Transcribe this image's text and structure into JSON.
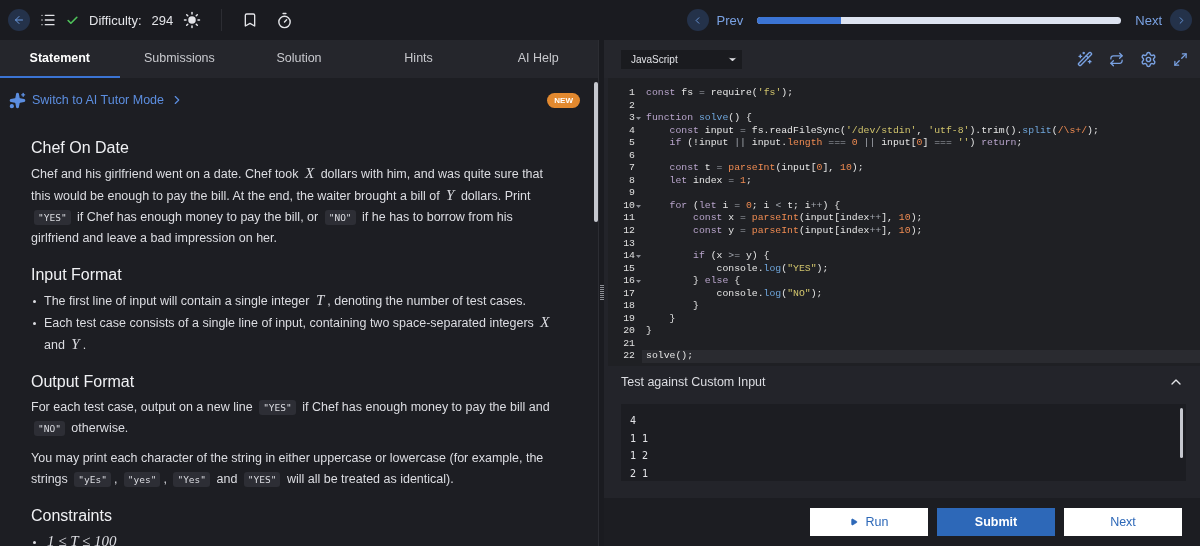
{
  "header": {
    "difficulty_label": "Difficulty:",
    "difficulty_value": "294",
    "solved": true,
    "prev_label": "Prev",
    "next_label": "Next",
    "progress": {
      "level": 0.23
    }
  },
  "tabs": [
    {
      "label": "Statement",
      "selected": true
    },
    {
      "label": "Submissions",
      "selected": false
    },
    {
      "label": "Solution",
      "selected": false
    },
    {
      "label": "Hints",
      "selected": false
    },
    {
      "label": "AI Help",
      "selected": false
    }
  ],
  "ai_tutor": {
    "label": "Switch to AI Tutor Mode",
    "badge": "NEW"
  },
  "statement": [
    {
      "heading": "Chef On Date",
      "blocks": [
        {
          "kind": "paragraph",
          "segments": [
            {
              "kind": "text",
              "text": "Chef and his girlfriend went on a date. Chef took "
            },
            {
              "kind": "math",
              "text": "X"
            },
            {
              "kind": "text",
              "text": " dollars with him, and was quite sure that this would be enough to pay the bill. At the end, the waiter brought a bill of "
            },
            {
              "kind": "math",
              "text": "Y"
            },
            {
              "kind": "text",
              "text": " dollars. Print "
            },
            {
              "kind": "code",
              "text": "\"YES\""
            },
            {
              "kind": "text",
              "text": " if Chef has enough money to pay the bill, or "
            },
            {
              "kind": "code",
              "text": "\"NO\""
            },
            {
              "kind": "text",
              "text": " if he has to borrow from his girlfriend and leave a bad impression on her."
            }
          ]
        }
      ]
    },
    {
      "heading": "Input Format",
      "blocks": [
        {
          "kind": "bullets",
          "items": [
            [
              {
                "kind": "text",
                "text": "The first line of input will contain a single integer "
              },
              {
                "kind": "math",
                "text": "T"
              },
              {
                "kind": "text",
                "text": ", denoting the number of test cases."
              }
            ],
            [
              {
                "kind": "text",
                "text": "Each test case consists of a single line of input, containing two space-separated integers "
              },
              {
                "kind": "math",
                "text": "X"
              },
              {
                "kind": "text",
                "text": " and "
              },
              {
                "kind": "math",
                "text": "Y"
              },
              {
                "kind": "text",
                "text": "."
              }
            ]
          ]
        }
      ]
    },
    {
      "heading": "Output Format",
      "blocks": [
        {
          "kind": "paragraph",
          "segments": [
            {
              "kind": "text",
              "text": "For each test case, output on a new line "
            },
            {
              "kind": "code",
              "text": "\"YES\""
            },
            {
              "kind": "text",
              "text": " if Chef has enough money to pay the bill and "
            },
            {
              "kind": "code",
              "text": "\"NO\""
            },
            {
              "kind": "text",
              "text": " otherwise."
            }
          ]
        },
        {
          "kind": "paragraph",
          "segments": [
            {
              "kind": "text",
              "text": "You may print each character of the string in either uppercase or lowercase (for example, the strings "
            },
            {
              "kind": "code",
              "text": "\"yEs\""
            },
            {
              "kind": "text",
              "text": ", "
            },
            {
              "kind": "code",
              "text": "\"yes\""
            },
            {
              "kind": "text",
              "text": ", "
            },
            {
              "kind": "code",
              "text": "\"Yes\""
            },
            {
              "kind": "text",
              "text": " and "
            },
            {
              "kind": "code",
              "text": "\"YES\""
            },
            {
              "kind": "text",
              "text": " will all be treated as identical)."
            }
          ]
        }
      ]
    },
    {
      "heading": "Constraints",
      "blocks": [
        {
          "kind": "bullets",
          "items": [
            [
              {
                "kind": "math",
                "text": "1 ≤ T ≤ 100"
              }
            ]
          ]
        }
      ]
    }
  ],
  "editor": {
    "language": "JavaScript",
    "lines": [
      {
        "number": "1",
        "foldable": false,
        "active": false,
        "tokens": [
          {
            "kind": "kw",
            "text": "const"
          },
          {
            "kind": "plain",
            "text": " fs "
          },
          {
            "kind": "op",
            "text": "="
          },
          {
            "kind": "plain",
            "text": " require("
          },
          {
            "kind": "str",
            "text": "'fs'"
          },
          {
            "kind": "plain",
            "text": ");"
          }
        ]
      },
      {
        "number": "2",
        "foldable": false,
        "active": false
      },
      {
        "number": "3",
        "foldable": true,
        "active": false,
        "tokens": [
          {
            "kind": "kw",
            "text": "function"
          },
          {
            "kind": "fn",
            "text": " solve"
          },
          {
            "kind": "plain",
            "text": "() {"
          }
        ]
      },
      {
        "number": "4",
        "foldable": false,
        "active": false,
        "tokens": [
          {
            "kind": "kw",
            "text": "    const"
          },
          {
            "kind": "plain",
            "text": " input "
          },
          {
            "kind": "op",
            "text": "="
          },
          {
            "kind": "plain",
            "text": " fs.readFileSync("
          },
          {
            "kind": "str",
            "text": "'/dev/stdin'"
          },
          {
            "kind": "plain",
            "text": ", "
          },
          {
            "kind": "str",
            "text": "'utf-8'"
          },
          {
            "kind": "plain",
            "text": ").trim()."
          },
          {
            "kind": "fn",
            "text": "split"
          },
          {
            "kind": "plain",
            "text": "("
          },
          {
            "kind": "num",
            "text": "/\\s+/"
          },
          {
            "kind": "plain",
            "text": ");"
          }
        ]
      },
      {
        "number": "5",
        "foldable": false,
        "active": false,
        "tokens": [
          {
            "kind": "kw",
            "text": "    if"
          },
          {
            "kind": "plain",
            "text": " (!input "
          },
          {
            "kind": "op",
            "text": "||"
          },
          {
            "kind": "plain",
            "text": " input."
          },
          {
            "kind": "num",
            "text": "length"
          },
          {
            "kind": "op",
            "text": " === "
          },
          {
            "kind": "num",
            "text": "0"
          },
          {
            "kind": "op",
            "text": " || "
          },
          {
            "kind": "plain",
            "text": "input["
          },
          {
            "kind": "num",
            "text": "0"
          },
          {
            "kind": "plain",
            "text": "] "
          },
          {
            "kind": "op",
            "text": "==="
          },
          {
            "kind": "str",
            "text": " ''"
          },
          {
            "kind": "plain",
            "text": ") "
          },
          {
            "kind": "kw",
            "text": "return"
          },
          {
            "kind": "plain",
            "text": ";"
          }
        ]
      },
      {
        "number": "6",
        "foldable": false,
        "active": false
      },
      {
        "number": "7",
        "foldable": false,
        "active": false,
        "tokens": [
          {
            "kind": "kw",
            "text": "    const"
          },
          {
            "kind": "plain",
            "text": " t "
          },
          {
            "kind": "op",
            "text": "="
          },
          {
            "kind": "num",
            "text": " parseInt"
          },
          {
            "kind": "plain",
            "text": "(input["
          },
          {
            "kind": "num",
            "text": "0"
          },
          {
            "kind": "plain",
            "text": "], "
          },
          {
            "kind": "num",
            "text": "10"
          },
          {
            "kind": "plain",
            "text": ");"
          }
        ]
      },
      {
        "number": "8",
        "foldable": false,
        "active": false,
        "tokens": [
          {
            "kind": "kw",
            "text": "    let"
          },
          {
            "kind": "plain",
            "text": " index "
          },
          {
            "kind": "op",
            "text": "="
          },
          {
            "kind": "num",
            "text": " 1"
          },
          {
            "kind": "plain",
            "text": ";"
          }
        ]
      },
      {
        "number": "9",
        "foldable": false,
        "active": false
      },
      {
        "number": "10",
        "foldable": true,
        "active": false,
        "tokens": [
          {
            "kind": "kw",
            "text": "    for"
          },
          {
            "kind": "plain",
            "text": " ("
          },
          {
            "kind": "kw",
            "text": "let"
          },
          {
            "kind": "plain",
            "text": " i "
          },
          {
            "kind": "op",
            "text": "="
          },
          {
            "kind": "num",
            "text": " 0"
          },
          {
            "kind": "plain",
            "text": "; i "
          },
          {
            "kind": "op",
            "text": "<"
          },
          {
            "kind": "plain",
            "text": " t; i"
          },
          {
            "kind": "op",
            "text": "++"
          },
          {
            "kind": "plain",
            "text": ") {"
          }
        ]
      },
      {
        "number": "11",
        "foldable": false,
        "active": false,
        "tokens": [
          {
            "kind": "kw",
            "text": "        const"
          },
          {
            "kind": "plain",
            "text": " x "
          },
          {
            "kind": "op",
            "text": "="
          },
          {
            "kind": "num",
            "text": " parseInt"
          },
          {
            "kind": "plain",
            "text": "(input[index"
          },
          {
            "kind": "op",
            "text": "++"
          },
          {
            "kind": "plain",
            "text": "], "
          },
          {
            "kind": "num",
            "text": "10"
          },
          {
            "kind": "plain",
            "text": ");"
          }
        ]
      },
      {
        "number": "12",
        "foldable": false,
        "active": false,
        "tokens": [
          {
            "kind": "kw",
            "text": "        const"
          },
          {
            "kind": "plain",
            "text": " y "
          },
          {
            "kind": "op",
            "text": "="
          },
          {
            "kind": "num",
            "text": " parseInt"
          },
          {
            "kind": "plain",
            "text": "(input[index"
          },
          {
            "kind": "op",
            "text": "++"
          },
          {
            "kind": "plain",
            "text": "], "
          },
          {
            "kind": "num",
            "text": "10"
          },
          {
            "kind": "plain",
            "text": ");"
          }
        ]
      },
      {
        "number": "13",
        "foldable": false,
        "active": false
      },
      {
        "number": "14",
        "foldable": true,
        "active": false,
        "tokens": [
          {
            "kind": "kw",
            "text": "        if"
          },
          {
            "kind": "plain",
            "text": " (x "
          },
          {
            "kind": "op",
            "text": ">="
          },
          {
            "kind": "plain",
            "text": " y) {"
          }
        ]
      },
      {
        "number": "15",
        "foldable": false,
        "active": false,
        "tokens": [
          {
            "kind": "plain",
            "text": "            console."
          },
          {
            "kind": "fn",
            "text": "log"
          },
          {
            "kind": "plain",
            "text": "("
          },
          {
            "kind": "str",
            "text": "\"YES\""
          },
          {
            "kind": "plain",
            "text": ");"
          }
        ]
      },
      {
        "number": "16",
        "foldable": true,
        "active": false,
        "tokens": [
          {
            "kind": "plain",
            "text": "        } "
          },
          {
            "kind": "kw",
            "text": "else"
          },
          {
            "kind": "plain",
            "text": " {"
          }
        ]
      },
      {
        "number": "17",
        "foldable": false,
        "active": false,
        "tokens": [
          {
            "kind": "plain",
            "text": "            console."
          },
          {
            "kind": "fn",
            "text": "log"
          },
          {
            "kind": "plain",
            "text": "("
          },
          {
            "kind": "str",
            "text": "\"NO\""
          },
          {
            "kind": "plain",
            "text": ");"
          }
        ]
      },
      {
        "number": "18",
        "foldable": false,
        "active": false,
        "tokens": [
          {
            "kind": "plain",
            "text": "        }"
          }
        ]
      },
      {
        "number": "19",
        "foldable": false,
        "active": false,
        "tokens": [
          {
            "kind": "plain",
            "text": "    }"
          }
        ]
      },
      {
        "number": "20",
        "foldable": false,
        "active": false,
        "tokens": [
          {
            "kind": "plain",
            "text": "}"
          }
        ]
      },
      {
        "number": "21",
        "foldable": false,
        "active": false
      },
      {
        "number": "22",
        "foldable": false,
        "active": true,
        "tokens": [
          {
            "kind": "plain",
            "text": "solve();"
          }
        ]
      }
    ]
  },
  "custom_input": {
    "title": "Test against Custom Input",
    "expanded": true,
    "value": "4\n1 1\n1 2\n2 1"
  },
  "buttons": [
    {
      "kind": "run",
      "label": "Run"
    },
    {
      "kind": "submit",
      "label": "Submit"
    },
    {
      "kind": "next",
      "label": "Next"
    }
  ]
}
